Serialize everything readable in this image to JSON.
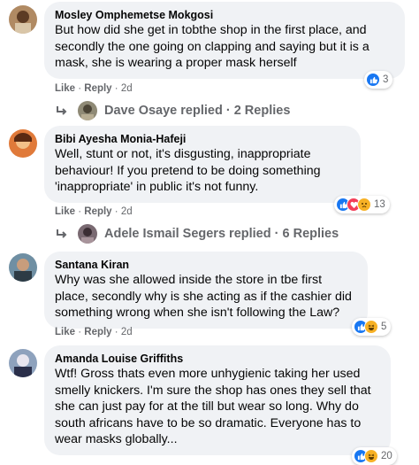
{
  "comments": [
    {
      "author": "Mosley Omphemetse Mokgosi",
      "text": "But how did she get in tobthe shop in the first place, and secondly the one going on clapping and saying but it is a mask, she is wearing a proper mask herself",
      "like": "Like",
      "reply": "Reply",
      "time": "2d",
      "reaction_count": "3",
      "replies": {
        "name": "Dave Osaye",
        "suffix": "replied",
        "count": "2 Replies"
      }
    },
    {
      "author": "Bibi Ayesha Monia-Hafeji",
      "text": "Well, stunt or not, it's disgusting, inappropriate behaviour! If you pretend to be doing something 'inappropriate' in public it's not funny.",
      "like": "Like",
      "reply": "Reply",
      "time": "2d",
      "reaction_count": "13",
      "replies": {
        "name": "Adele Ismail Segers",
        "suffix": "replied",
        "count": "6 Replies"
      }
    },
    {
      "author": "Santana Kiran",
      "text": "Why was she allowed inside the store in tbe first place, secondly why is she acting as if the cashier did something wrong when she isn't following the Law?",
      "like": "Like",
      "reply": "Reply",
      "time": "2d",
      "reaction_count": "5"
    },
    {
      "author": "Amanda Louise Griffiths",
      "text": "Wtf! Gross thats even more unhygienic taking her used smelly knickers. I'm sure the shop has ones they sell that she can just pay for at the till but wear so long. Why do south africans have to be so dramatic. Everyone has to wear masks globally...",
      "reaction_count": "20"
    }
  ],
  "separator": "·",
  "colors": {
    "bubble": "#f0f2f5",
    "meta": "#65676b",
    "like_blue": "#1877f2",
    "love_red": "#f33e58",
    "haha_yellow": "#f7b125"
  },
  "icons": [
    "like-reaction-icon",
    "love-reaction-icon",
    "sad-reaction-icon",
    "haha-reaction-icon",
    "reply-arrow-icon"
  ]
}
